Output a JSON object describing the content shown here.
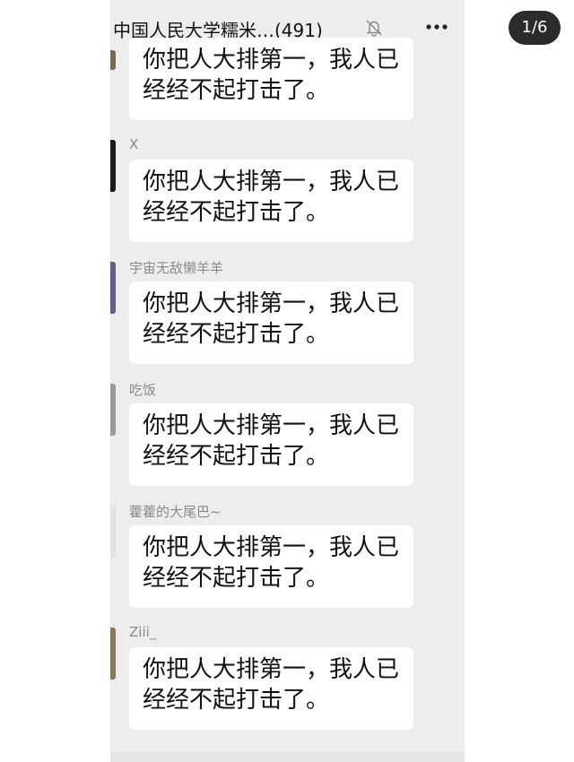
{
  "header": {
    "title": "中国人民大学糯米…",
    "member_count": "(491)",
    "mute_icon": "bell-slash-icon",
    "more_icon": "more-dots-icon"
  },
  "page_indicator": "1/6",
  "messages": [
    {
      "sender": "",
      "text": "你把人大排第一，我人已经经不起打击了。"
    },
    {
      "sender": "X",
      "text": "你把人大排第一，我人已经经不起打击了。"
    },
    {
      "sender": "宇宙无敌懒羊羊",
      "text": "你把人大排第一，我人已经经不起打击了。"
    },
    {
      "sender": "吃饭",
      "text": "你把人大排第一，我人已经经不起打击了。"
    },
    {
      "sender": "藿藿的大尾巴~",
      "text": "你把人大排第一，我人已经经不起打击了。"
    },
    {
      "sender": "Ziii_",
      "text": "你把人大排第一，我人已经经不起打击了。"
    }
  ],
  "colors": {
    "chat_background": "#ededed",
    "bubble": "#ffffff",
    "sender_name": "#8a8a8a"
  }
}
